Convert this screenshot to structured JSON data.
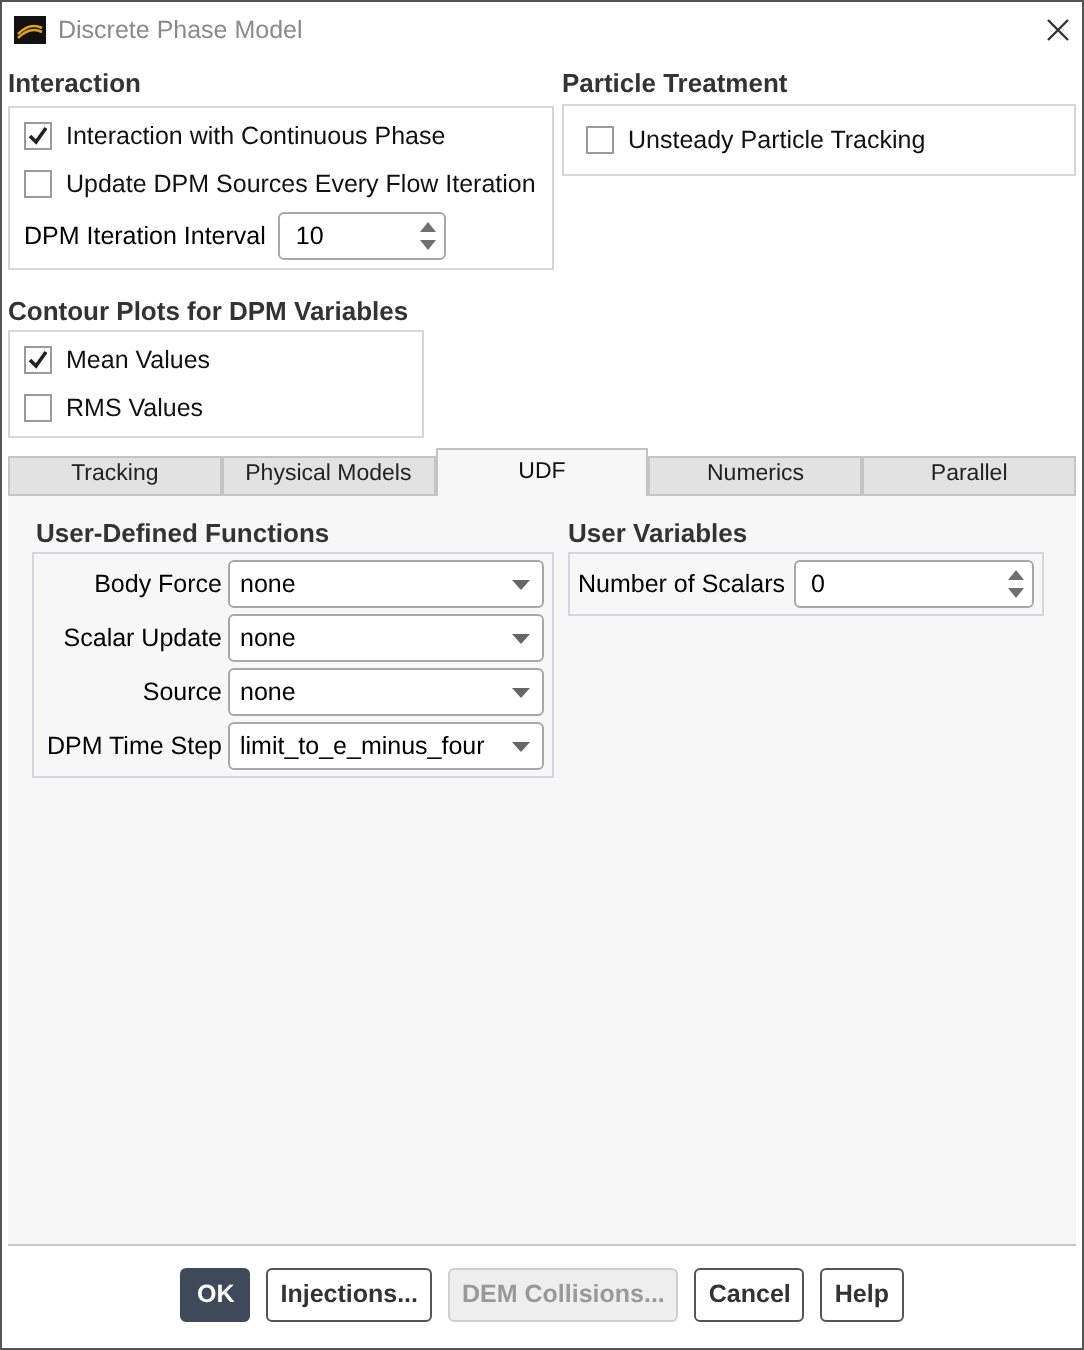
{
  "window": {
    "title": "Discrete Phase Model"
  },
  "interaction": {
    "title": "Interaction",
    "options": [
      {
        "label": "Interaction with Continuous Phase",
        "checked": true
      },
      {
        "label": "Update DPM Sources Every Flow Iteration",
        "checked": false
      }
    ],
    "iteration_interval": {
      "label": "DPM Iteration Interval",
      "value": "10"
    }
  },
  "particle_treatment": {
    "title": "Particle Treatment",
    "options": [
      {
        "label": "Unsteady Particle Tracking",
        "checked": false
      }
    ]
  },
  "contour_plots": {
    "title": "Contour Plots for DPM Variables",
    "options": [
      {
        "label": "Mean Values",
        "checked": true
      },
      {
        "label": "RMS Values",
        "checked": false
      }
    ]
  },
  "tabs": [
    {
      "label": "Tracking",
      "selected": false
    },
    {
      "label": "Physical Models",
      "selected": false
    },
    {
      "label": "UDF",
      "selected": true
    },
    {
      "label": "Numerics",
      "selected": false
    },
    {
      "label": "Parallel",
      "selected": false
    }
  ],
  "udf": {
    "title": "User-Defined Functions",
    "fields": [
      {
        "label": "Body Force",
        "value": "none"
      },
      {
        "label": "Scalar Update",
        "value": "none"
      },
      {
        "label": "Source",
        "value": "none"
      },
      {
        "label": "DPM Time Step",
        "value": "limit_to_e_minus_four"
      }
    ]
  },
  "user_variables": {
    "title": "User Variables",
    "number_of_scalars": {
      "label": "Number of Scalars",
      "value": "0"
    }
  },
  "buttons": [
    {
      "label": "OK",
      "kind": "primary",
      "disabled": false
    },
    {
      "label": "Injections...",
      "kind": "normal",
      "disabled": false
    },
    {
      "label": "DEM Collisions...",
      "kind": "normal",
      "disabled": true
    },
    {
      "label": "Cancel",
      "kind": "normal",
      "disabled": false
    },
    {
      "label": "Help",
      "kind": "normal",
      "disabled": false
    }
  ]
}
